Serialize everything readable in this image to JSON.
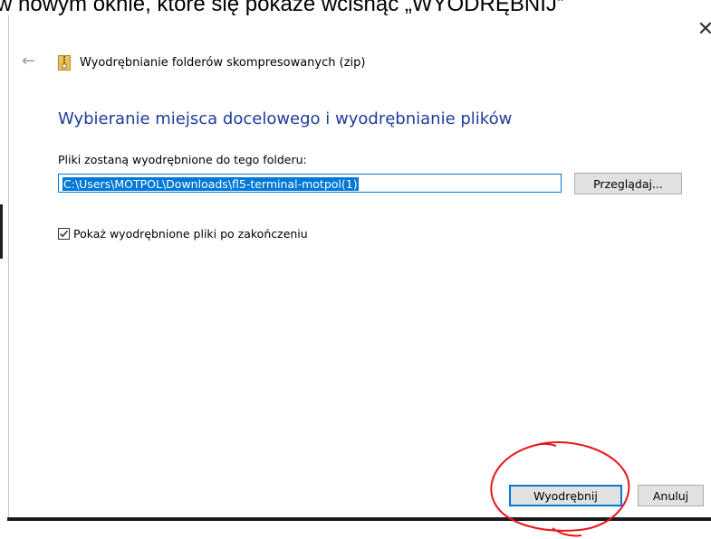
{
  "background": {
    "caption": "w nowym oknie, które się pokaże wciśnąć „WYODRĘBNIJ”"
  },
  "dialog": {
    "close_glyph": "✕",
    "back_glyph": "←",
    "title": "Wyodrębnianie folderów skompresowanych (zip)",
    "heading": "Wybieranie miejsca docelowego i wyodrębnianie plików",
    "folder_label": "Pliki zostaną wyodrębnione do tego folderu:",
    "path_value": "C:\\Users\\MOTPOL\\Downloads\\fl5-terminal-motpol(1)",
    "browse_label": "Przeglądaj...",
    "show_files_label": "Pokaż wyodrębnione pliki po zakończeniu",
    "show_files_checked": true,
    "extract_label": "Wyodrębnij",
    "cancel_label": "Anuluj"
  },
  "colors": {
    "heading": "#1e3c9b",
    "accent": "#0078d7",
    "annotation": "#e8141b"
  }
}
